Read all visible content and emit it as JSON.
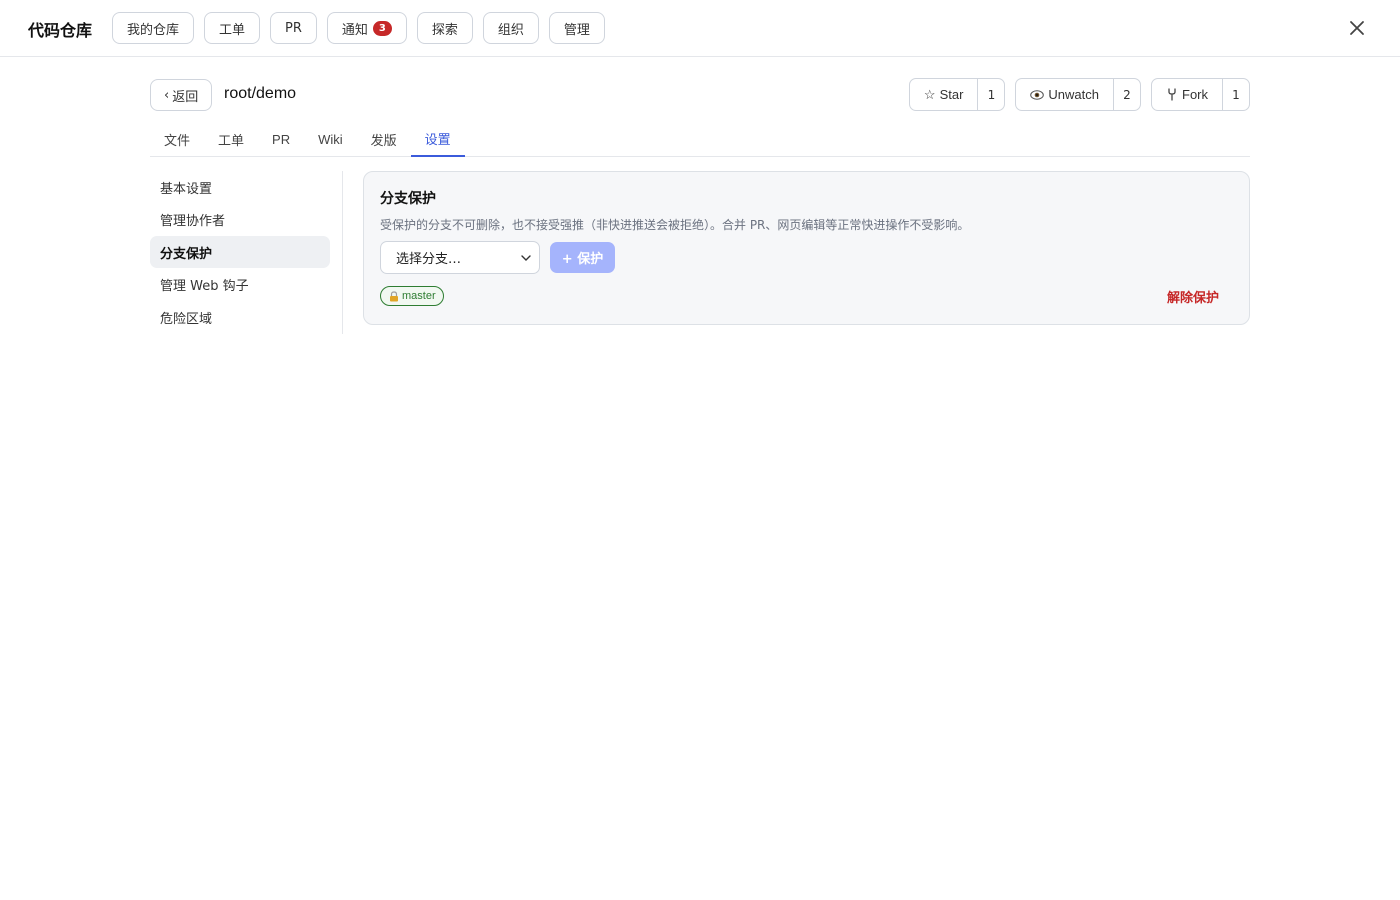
{
  "app": {
    "title": "代码仓库"
  },
  "nav": [
    {
      "label": "我的仓库"
    },
    {
      "label": "工单"
    },
    {
      "label": "PR"
    },
    {
      "label": "通知",
      "badge": "3"
    },
    {
      "label": "探索"
    },
    {
      "label": "组织"
    },
    {
      "label": "管理"
    }
  ],
  "repo": {
    "back_label": "返回",
    "name": "root/demo",
    "star_label": "Star",
    "star_count": "1",
    "watch_label": "Unwatch",
    "watch_count": "2",
    "fork_label": "Fork",
    "fork_count": "1"
  },
  "tabs": [
    {
      "label": "文件"
    },
    {
      "label": "工单"
    },
    {
      "label": "PR"
    },
    {
      "label": "Wiki"
    },
    {
      "label": "发版"
    },
    {
      "label": "设置",
      "active": true
    }
  ],
  "sidebar": [
    {
      "label": "基本设置"
    },
    {
      "label": "管理协作者"
    },
    {
      "label": "分支保护",
      "active": true
    },
    {
      "label": "管理 Web 钩子"
    },
    {
      "label": "危险区域"
    }
  ],
  "panel": {
    "title": "分支保护",
    "description": "受保护的分支不可删除，也不接受强推（非快进推送会被拒绝）。合并 PR、网页编辑等正常快进操作不受影响。",
    "select_value": "选择分支…",
    "protect_button": "+ 保护",
    "protected_branch": "master",
    "unprotect_label": "解除保护"
  },
  "colors": {
    "accent": "#3b5bdb",
    "danger": "#c62828",
    "success": "#2e7d32"
  }
}
